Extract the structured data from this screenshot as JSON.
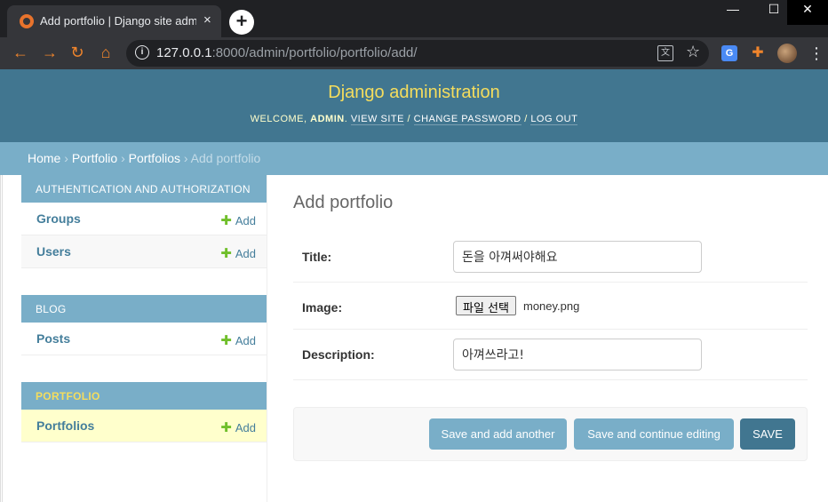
{
  "browser": {
    "tab_title": "Add portfolio | Django site admin",
    "tab_close": "×",
    "new_tab": "+",
    "window_controls": {
      "minimize": "—",
      "maximize": "☐",
      "close": "✕"
    },
    "nav": {
      "back": "←",
      "forward": "→",
      "reload": "↻",
      "home": "⌂"
    },
    "url_host": "127.0.0.1",
    "url_rest": ":8000/admin/portfolio/portfolio/add/",
    "info_glyph": "i",
    "translate_glyph": "文",
    "star_glyph": "☆",
    "ext_google_translate": "G",
    "ext_puzzle": "✚",
    "menu_glyph": "⋮",
    "icons": [
      "django-favicon",
      "back-icon",
      "forward-icon",
      "reload-icon",
      "home-icon",
      "info-icon",
      "translate-icon",
      "bookmark-star-icon",
      "google-translate-icon",
      "extensions-icon",
      "profile-avatar",
      "menu-icon"
    ],
    "accent_color": "#f0852c"
  },
  "header": {
    "site_name": "Django administration",
    "welcome": "WELCOME,",
    "user": "ADMIN",
    "view_site": "VIEW SITE",
    "change_password": "CHANGE PASSWORD",
    "log_out": "LOG OUT",
    "sep": "/"
  },
  "breadcrumbs": {
    "home": "Home",
    "app": "Portfolio",
    "model": "Portfolios",
    "current": "Add portfolio",
    "sep": "›"
  },
  "sidebar": {
    "add_label": "Add",
    "plus": "✚",
    "modules": [
      {
        "caption": "Authentication and Authorization",
        "rows": [
          {
            "name": "Groups"
          },
          {
            "name": "Users"
          }
        ]
      },
      {
        "caption": "Blog",
        "rows": [
          {
            "name": "Posts"
          }
        ]
      },
      {
        "caption": "Portfolio",
        "rows": [
          {
            "name": "Portfolios"
          }
        ]
      }
    ]
  },
  "form": {
    "title": "Add portfolio",
    "title_label": "Title:",
    "title_value": "돈을 아껴써야해요",
    "image_label": "Image:",
    "file_button": "파일 선택",
    "file_name": "money.png",
    "description_label": "Description:",
    "description_value": "아껴쓰라고!",
    "save_add_another": "Save and add another",
    "save_continue": "Save and continue editing",
    "save": "SAVE"
  },
  "colors": {
    "header_bg": "#417690",
    "breadcrumb_bg": "#79aec8",
    "site_name": "#f5dd5d",
    "link": "#447e9b",
    "add_plus": "#70bf2b",
    "selected_row": "#ffffcc"
  }
}
